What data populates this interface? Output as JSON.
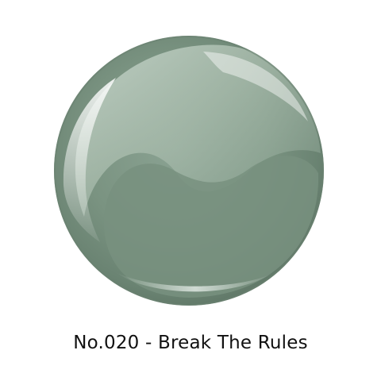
{
  "product": {
    "caption": "No.020 - Break The Rules",
    "swatch_icon": "color-swatch-orb",
    "colors": {
      "base": "#78917f",
      "light": "#a4b8aa",
      "dark": "#5d7464",
      "rim": "#c9d6cc",
      "highlight": "#f4f8f5"
    }
  }
}
